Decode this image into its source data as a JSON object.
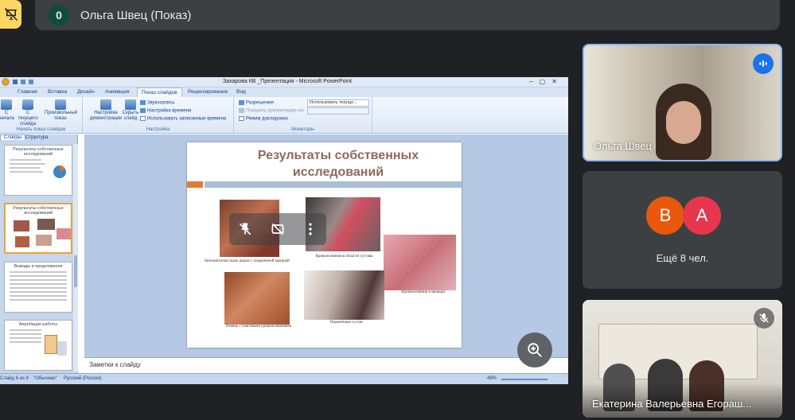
{
  "meeting": {
    "participant_count": "0",
    "presenter_label": "Ольга Швец (Показ)"
  },
  "powerpoint": {
    "window_title": "Захарова КВ _Презентация - Microsoft PowerPoint",
    "tabs": [
      "Главная",
      "Вставка",
      "Дизайн",
      "Анимация",
      "Показ слайдов",
      "Рецензирование",
      "Вид"
    ],
    "active_tab": "Показ слайдов",
    "ribbon": {
      "start_group": "Начать показ слайдов",
      "btn_from_start": "С начала",
      "btn_from_current": "С текущего слайда",
      "btn_custom": "Произвольный показ",
      "btn_setup": "Настройка демонстрации",
      "btn_hide": "Скрыть слайд",
      "setup_group": "Настройка",
      "record_narration": "Звукозапись",
      "rehearse_timings": "Настройка времени",
      "use_timings": "Использовать записанные времена",
      "monitors_group": "Мониторы",
      "resolution_label": "Разрешение:",
      "resolution_value": "Использовать текуще...",
      "show_on_label": "Показать презентацию на:",
      "presenter_view": "Режим докладчика"
    },
    "panel_tabs": [
      "Слайды",
      "Структура"
    ],
    "thumbnails": [
      {
        "title": "Результаты собственных исследований"
      },
      {
        "title": "Результаты собственных исследований"
      },
      {
        "title": "Выводы и предложения"
      },
      {
        "title": "Апробация работы"
      }
    ],
    "slide": {
      "title": "Результаты собственных исследований",
      "captions": [
        "Липоматозная ткань рядом с поражённой мышцей",
        "Кровоизлияния в области сустава",
        "Кровоизлияния в мышцах",
        "Печень с очаговыми кровоизлияниями",
        "Поражённая сустав"
      ]
    },
    "notes_placeholder": "Заметки к слайду",
    "status": {
      "slide_index": "Слайд 6 из 9",
      "theme": "\"Обычная\"",
      "language": "Русский (Россия)",
      "zoom": "49%"
    }
  },
  "tiles": {
    "video1_name": "Ольга Швец",
    "avatar_b": "В",
    "avatar_a": "А",
    "avatar_b_color": "#e8590c",
    "avatar_a_color": "#e8364f",
    "others_label": "Ещё 8 чел.",
    "video2_name": "Екатерина Валерьевна Егораш..."
  },
  "icons": {
    "present": "presentation-icon",
    "speaking": "speaking-indicator-icon",
    "mic_off": "mic-off-icon",
    "zoom": "zoom-in-icon"
  }
}
